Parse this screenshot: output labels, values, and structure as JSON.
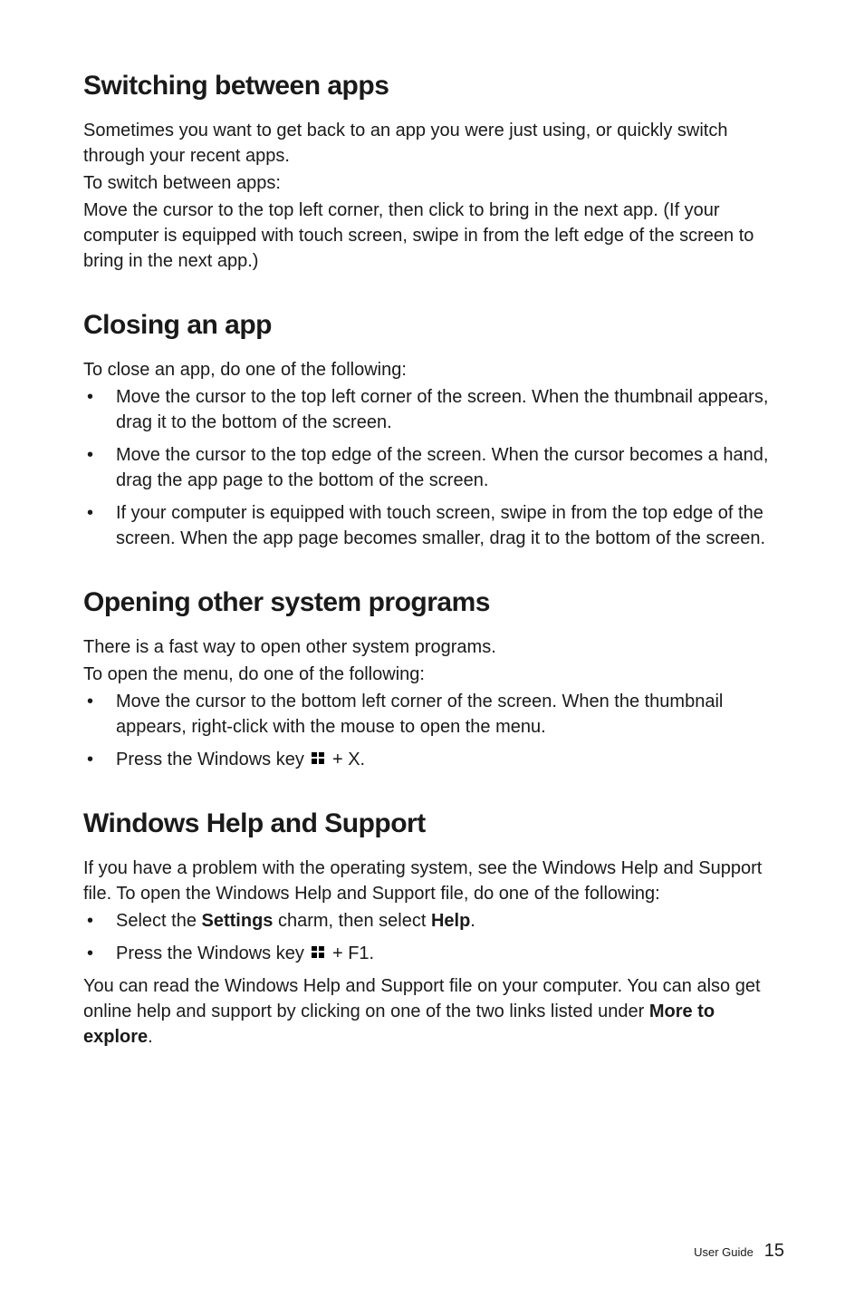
{
  "sections": {
    "switching": {
      "heading": "Switching between apps",
      "p1": "Sometimes you want to get back to an app you were just using, or quickly switch through your recent apps.",
      "p2": "To switch between apps:",
      "p3": "Move the cursor to the top left corner, then click to bring in the next app. (If your computer is equipped with touch screen, swipe in from the left edge of the screen to bring in the next app.)"
    },
    "closing": {
      "heading": "Closing an app",
      "p1": "To close an app, do one of the following:",
      "bullets": [
        "Move the cursor to the top left corner of the screen. When the thumbnail appears, drag it to the bottom of the screen.",
        "Move the cursor to the top edge of the screen. When the cursor becomes a hand, drag the app page to the bottom of the screen.",
        "If your computer is equipped with touch screen, swipe in from the top edge of the screen. When the app page becomes smaller, drag it to the bottom of the screen."
      ]
    },
    "opening": {
      "heading": "Opening other system programs",
      "p1": "There is a fast way to open other system programs.",
      "p2": "To open the menu, do one of the following:",
      "bullets": [
        "Move the cursor to the bottom left corner of the screen. When the thumbnail appears, right-click with the mouse to open the menu."
      ],
      "winkey_prefix": "Press the Windows key ",
      "winkey_suffix_x": " + X."
    },
    "help": {
      "heading": "Windows Help and Support",
      "p1": "If you have a problem with the operating system, see the Windows Help and Support file. To open the Windows Help and Support file, do one of the following:",
      "b1_prefix": "Select the ",
      "b1_bold1": "Settings",
      "b1_mid": " charm, then select ",
      "b1_bold2": "Help",
      "b1_suffix": ".",
      "winkey_prefix": "Press the Windows key ",
      "winkey_suffix_f1": " + F1.",
      "p2_prefix": "You can read the Windows Help and Support file on your computer. You can also get online help and support by clicking on one of the two links listed under ",
      "p2_bold": "More to explore",
      "p2_suffix": "."
    }
  },
  "footer": {
    "label": "User Guide",
    "page": "15"
  }
}
